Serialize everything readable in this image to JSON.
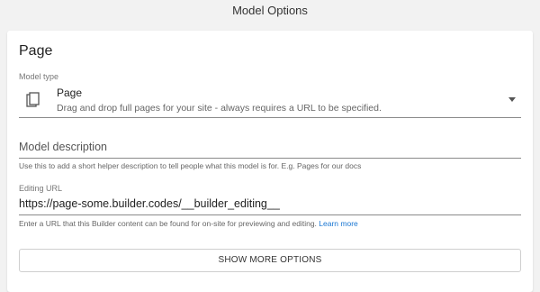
{
  "window": {
    "title": "Model Options"
  },
  "card": {
    "title": "Page",
    "model_type": {
      "label": "Model type",
      "selected_title": "Page",
      "selected_description": "Drag and drop full pages for your site - always requires a URL to be specified.",
      "icon": "document-copy-icon"
    },
    "model_description": {
      "placeholder": "Model description",
      "value": "",
      "helper": "Use this to add a short helper description to tell people what this model is for. E.g. Pages for our docs"
    },
    "editing_url": {
      "label": "Editing URL",
      "value": "https://page-some.builder.codes/__builder_editing__",
      "helper": "Enter a URL that this Builder content can be found for on-site for previewing and editing.",
      "learn_more": "Learn more"
    },
    "show_more_button": "SHOW MORE OPTIONS"
  },
  "colors": {
    "accent_link": "#1976d2",
    "background": "#f2f2f2"
  }
}
